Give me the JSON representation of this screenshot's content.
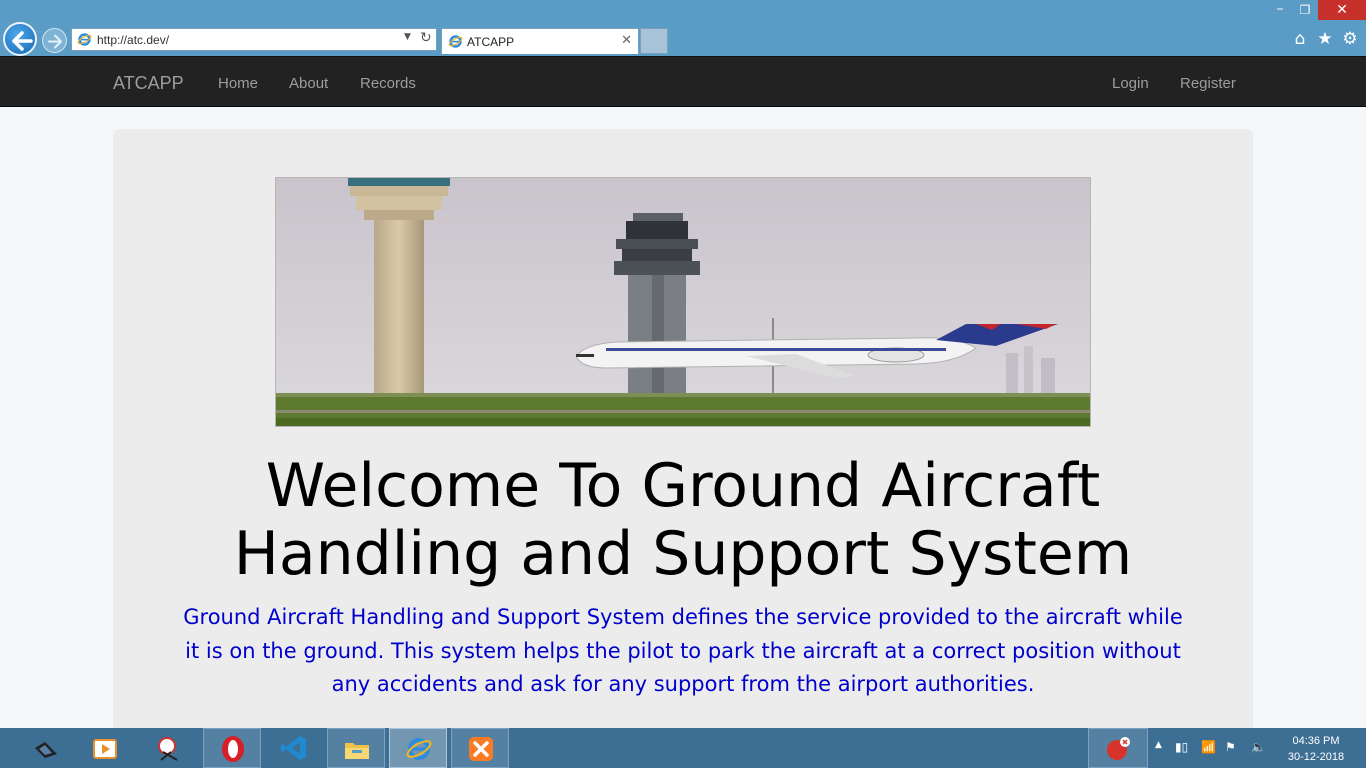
{
  "browser": {
    "address_url": "http://atc.dev/",
    "tab_title": "ATCAPP",
    "window_controls": {
      "minimize": "–",
      "maximize": "❐",
      "close": "✕"
    },
    "toolbar_icons": [
      "home-icon",
      "favorites-star-icon",
      "settings-gear-icon"
    ]
  },
  "navbar": {
    "brand": "ATCAPP",
    "left_links": [
      {
        "label": "Home"
      },
      {
        "label": "About"
      },
      {
        "label": "Records"
      }
    ],
    "right_links": [
      {
        "label": "Login"
      },
      {
        "label": "Register"
      }
    ]
  },
  "main": {
    "headline_line1": "Welcome To Ground Aircraft",
    "headline_line2": "Handling and Support System",
    "lead": "Ground Aircraft Handling and Support System defines the service provided to the aircraft while it is on the ground. This system helps the pilot to park the aircraft at a correct position without any accidents and ask for any support from the airport authorities."
  },
  "taskbar": {
    "apps": [
      "desktop-show-icon",
      "media-player-icon",
      "snipping-tool-icon",
      "opera-browser-icon",
      "visual-studio-code-icon",
      "file-explorer-icon",
      "internet-explorer-icon",
      "xampp-icon"
    ],
    "clock_time": "04:36 PM",
    "clock_date": "30-12-2018"
  },
  "colors": {
    "chrome_bg": "#5b9cc6",
    "navbar_bg": "#222222",
    "nav_text": "#9d9d9d",
    "jumbotron_bg": "#ececec",
    "lead_text": "#0000cc",
    "taskbar_bg": "#3d6f94"
  }
}
